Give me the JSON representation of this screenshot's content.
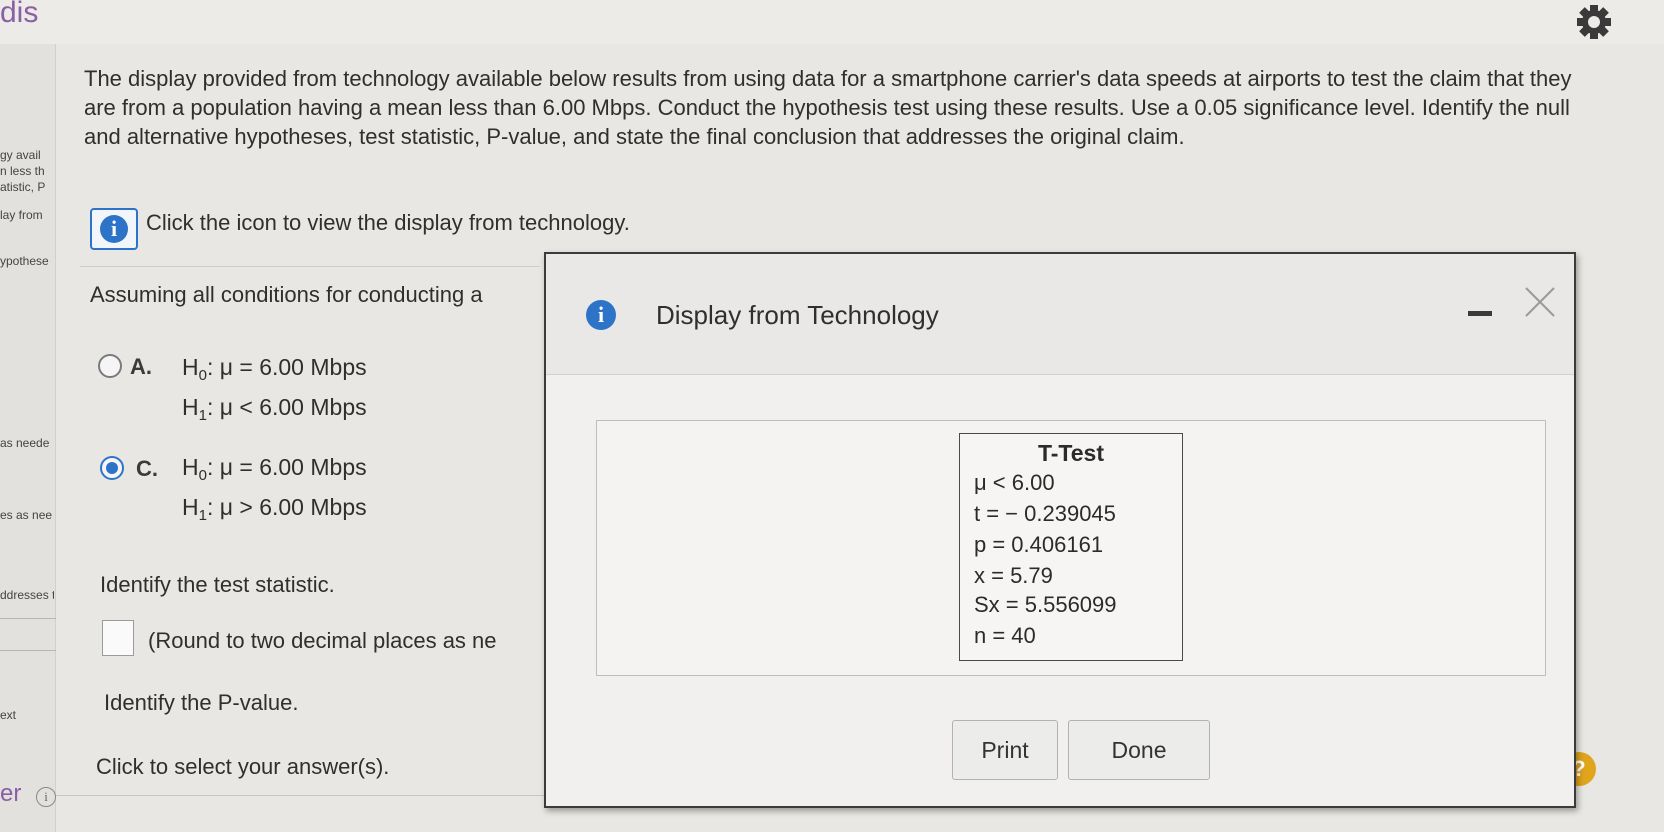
{
  "topbar": {
    "title": "dis"
  },
  "sidebar": {
    "fragments": [
      "gy avail",
      "n less th",
      "atistic, P",
      "lay from",
      "ypothese",
      "as neede",
      "es as nee",
      "ddresses t",
      "ext"
    ],
    "footer_label": "er",
    "footer_icon": "i"
  },
  "question": {
    "text": "The display provided from technology available below results from using data for a smartphone carrier's data speeds at airports to test the claim that they are from a population having a mean less than 6.00 Mbps. Conduct the hypothesis test using these results. Use a 0.05 significance level. Identify the null and alternative hypotheses, test statistic, P-value, and state the final conclusion that addresses the original claim.",
    "info_icon": "i",
    "info_link_text": "Click the icon to view the display from technology."
  },
  "assumption_text": "Assuming all conditions for conducting a",
  "options": [
    {
      "letter": "A.",
      "selected": false,
      "h0_prefix": "H",
      "h0_sub": "0",
      "h0_rest": ": μ = 6.00 Mbps",
      "h1_prefix": "H",
      "h1_sub": "1",
      "h1_rest": ": μ < 6.00 Mbps"
    },
    {
      "letter": "C.",
      "selected": true,
      "h0_prefix": "H",
      "h0_sub": "0",
      "h0_rest": ": μ = 6.00 Mbps",
      "h1_prefix": "H",
      "h1_sub": "1",
      "h1_rest": ": μ > 6.00 Mbps"
    }
  ],
  "prompts": {
    "test_statistic": "Identify the test statistic.",
    "round_note": "(Round to two decimal places as ne",
    "p_value": "Identify the P-value.",
    "select": "Click to select your answer(s)."
  },
  "help_icon": "?",
  "dialog": {
    "icon": "i",
    "title": "Display from Technology",
    "ttest": {
      "heading": "T-Test",
      "rows": [
        "μ < 6.00",
        "t = − 0.239045",
        "p = 0.406161",
        "x = 5.79",
        "Sx = 5.556099",
        "n = 40"
      ]
    },
    "buttons": {
      "print": "Print",
      "done": "Done"
    }
  },
  "colors": {
    "accent": "#2d74c9",
    "brand": "#8a5fa5",
    "help": "#e0a51c"
  }
}
